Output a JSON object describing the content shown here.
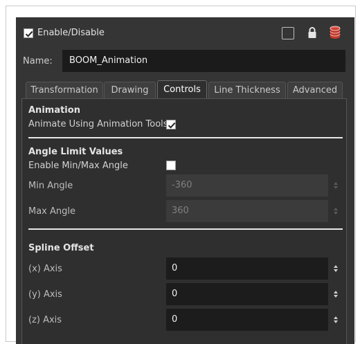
{
  "header": {
    "enable_label": "Enable/Disable",
    "enable_checked": true,
    "icons": [
      "lock-toggle-box-icon",
      "padlock-icon",
      "database-icon"
    ]
  },
  "name_row": {
    "label": "Name:",
    "value": "BOOM_Animation"
  },
  "tabs": [
    {
      "label": "Transformation",
      "active": false
    },
    {
      "label": "Drawing",
      "active": false
    },
    {
      "label": "Controls",
      "active": true
    },
    {
      "label": "Line Thickness",
      "active": false
    },
    {
      "label": "Advanced",
      "active": false
    }
  ],
  "animation": {
    "title": "Animation",
    "animate_tools_label": "Animate Using Animation Tools",
    "animate_tools_checked": true
  },
  "angle_limits": {
    "title": "Angle Limit Values",
    "enable_label": "Enable Min/Max Angle",
    "enable_checked": false,
    "min_label": "Min Angle",
    "min_value": "-360",
    "max_label": "Max Angle",
    "max_value": "360"
  },
  "spline_offset": {
    "title": "Spline Offset",
    "x_label": "(x) Axis",
    "x_value": "0",
    "y_label": "(y) Axis",
    "y_value": "0",
    "z_label": "(z) Axis",
    "z_value": "0"
  },
  "colors": {
    "panel": "#353535",
    "content": "#2f2f2f",
    "field": "#1c1c1c",
    "db_red": "#c0392b"
  }
}
